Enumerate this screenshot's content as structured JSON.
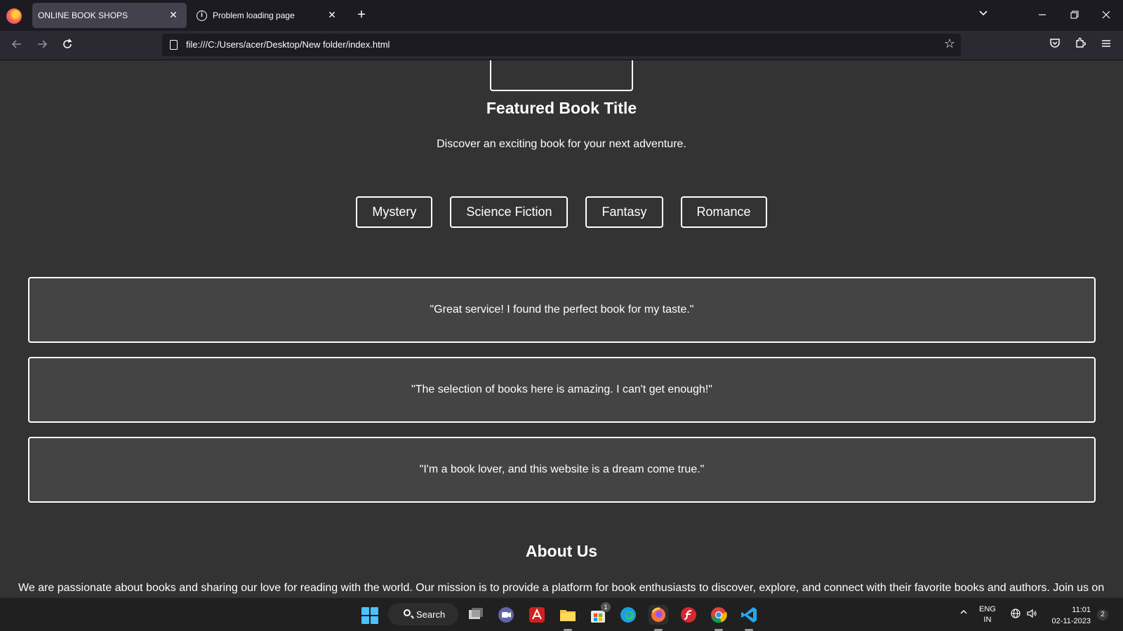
{
  "browser": {
    "tabs": [
      {
        "label": "ONLINE BOOK SHOPS",
        "active": true
      },
      {
        "label": "Problem loading page",
        "active": false
      }
    ],
    "new_tab_symbol": "+",
    "close_symbol": "✕",
    "url": "file:///C:/Users/acer/Desktop/New folder/index.html",
    "icons": [
      "firefox-logo-icon",
      "back-icon",
      "forward-icon",
      "reload-icon",
      "page-icon",
      "bookmark-star-icon",
      "pocket-icon",
      "extensions-icon",
      "menu-icon",
      "tab-list-icon",
      "minimize-icon",
      "restore-icon",
      "close-window-icon"
    ]
  },
  "page": {
    "featured_title": "Featured Book Title",
    "featured_description": "Discover an exciting book for your next adventure.",
    "genres": [
      "Mystery",
      "Science Fiction",
      "Fantasy",
      "Romance"
    ],
    "testimonials": [
      "\"Great service! I found the perfect book for my taste.\"",
      "\"The selection of books here is amazing. I can't get enough!\"",
      "\"I'm a book lover, and this website is a dream come true.\""
    ],
    "about_title": "About Us",
    "about_text": "We are passionate about books and sharing our love for reading with the world. Our mission is to provide a platform for book enthusiasts to discover, explore, and connect with their favorite books and authors. Join us on"
  },
  "taskbar": {
    "search_label": "Search",
    "store_badge": "1",
    "language_line1": "ENG",
    "language_line2": "IN",
    "time": "11:01",
    "date": "02-11-2023",
    "notification_count": "2",
    "apps": [
      "task-view-icon",
      "teams-chat-icon",
      "acrobat-icon",
      "file-explorer-icon",
      "microsoft-store-icon",
      "edge-icon",
      "firefox-icon",
      "flash-icon",
      "chrome-icon",
      "vscode-icon"
    ]
  },
  "colors": {
    "page_bg": "#333333",
    "testimonial_bg": "#444444",
    "chrome_bg": "#1c1b22",
    "toolbar_bg": "#2b2a33",
    "accent_start": "#4cc2ff"
  }
}
